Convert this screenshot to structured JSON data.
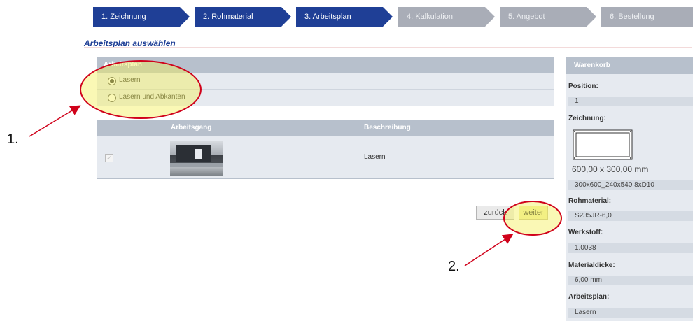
{
  "steps": [
    {
      "label": "1. Zeichnung",
      "state": "active"
    },
    {
      "label": "2. Rohmaterial",
      "state": "active"
    },
    {
      "label": "3. Arbeitsplan",
      "state": "active"
    },
    {
      "label": "4. Kalkulation",
      "state": "inactive"
    },
    {
      "label": "5. Angebot",
      "state": "inactive"
    },
    {
      "label": "6. Bestellung",
      "state": "inactive"
    }
  ],
  "section_title": "Arbeitsplan auswählen",
  "arbeitsplan": {
    "header": "Arbeitsplan",
    "options": [
      {
        "label": "Lasern",
        "selected": true
      },
      {
        "label": "Lasern und Abkanten",
        "selected": false
      }
    ]
  },
  "table": {
    "headers": {
      "arbeitsgang": "Arbeitsgang",
      "beschreibung": "Beschreibung"
    },
    "rows": [
      {
        "checked": true,
        "beschreibung": "Lasern"
      }
    ]
  },
  "buttons": {
    "back": "zurück",
    "next": "weiter"
  },
  "warenkorb": {
    "title": "Warenkorb",
    "position_label": "Position:",
    "position_value": "1",
    "zeichnung_label": "Zeichnung:",
    "dimensions": "600,00 x 300,00 mm",
    "drawing_name": "300x600_240x540 8xD10",
    "rohmaterial_label": "Rohmaterial:",
    "rohmaterial_value": "S235JR-6,0",
    "werkstoff_label": "Werkstoff:",
    "werkstoff_value": "1.0038",
    "materialdicke_label": "Materialdicke:",
    "materialdicke_value": "6,00 mm",
    "arbeitsplan_label": "Arbeitsplan:",
    "arbeitsplan_value": "Lasern"
  },
  "annotations": {
    "one": "1.",
    "two": "2."
  },
  "colors": {
    "step_active": "#1f3f96",
    "step_inactive": "#a9adb7",
    "annotation": "#d0021b",
    "highlight": "#f5f05a"
  }
}
